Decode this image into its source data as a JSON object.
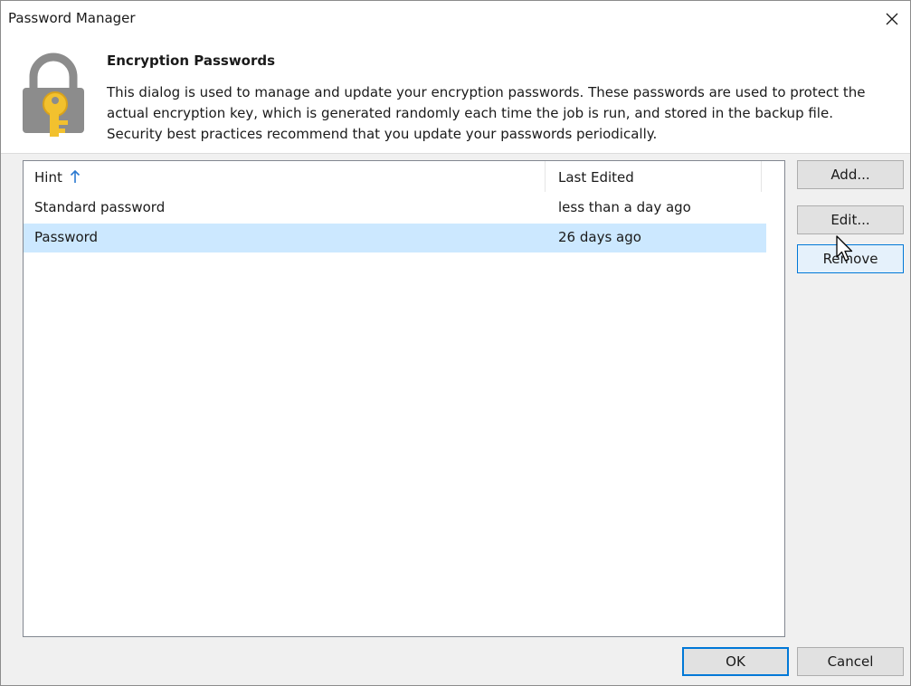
{
  "window": {
    "title": "Password Manager"
  },
  "header": {
    "title": "Encryption Passwords",
    "description_lines": [
      "This dialog is used to manage and update your encryption passwords. These passwords are used to protect the",
      "actual encryption key, which is generated randomly each time the job is run, and stored in the backup file.",
      "Security best practices recommend that you update your passwords periodically."
    ]
  },
  "table": {
    "columns": [
      "Hint",
      "Last Edited"
    ],
    "sort": {
      "column": "Hint",
      "direction": "ascending",
      "icon": "arrow-up-icon"
    },
    "rows": [
      {
        "hint": "Standard password",
        "last_edited": "less than a day ago",
        "selected": false
      },
      {
        "hint": "Password",
        "last_edited": "26 days ago",
        "selected": true
      }
    ]
  },
  "buttons": {
    "add": "Add...",
    "edit": "Edit...",
    "remove": "Remove",
    "ok": "OK",
    "cancel": "Cancel"
  },
  "colors": {
    "selection": "#cce8ff",
    "accent": "#0078d7",
    "sort_arrow": "#2b79d0"
  }
}
